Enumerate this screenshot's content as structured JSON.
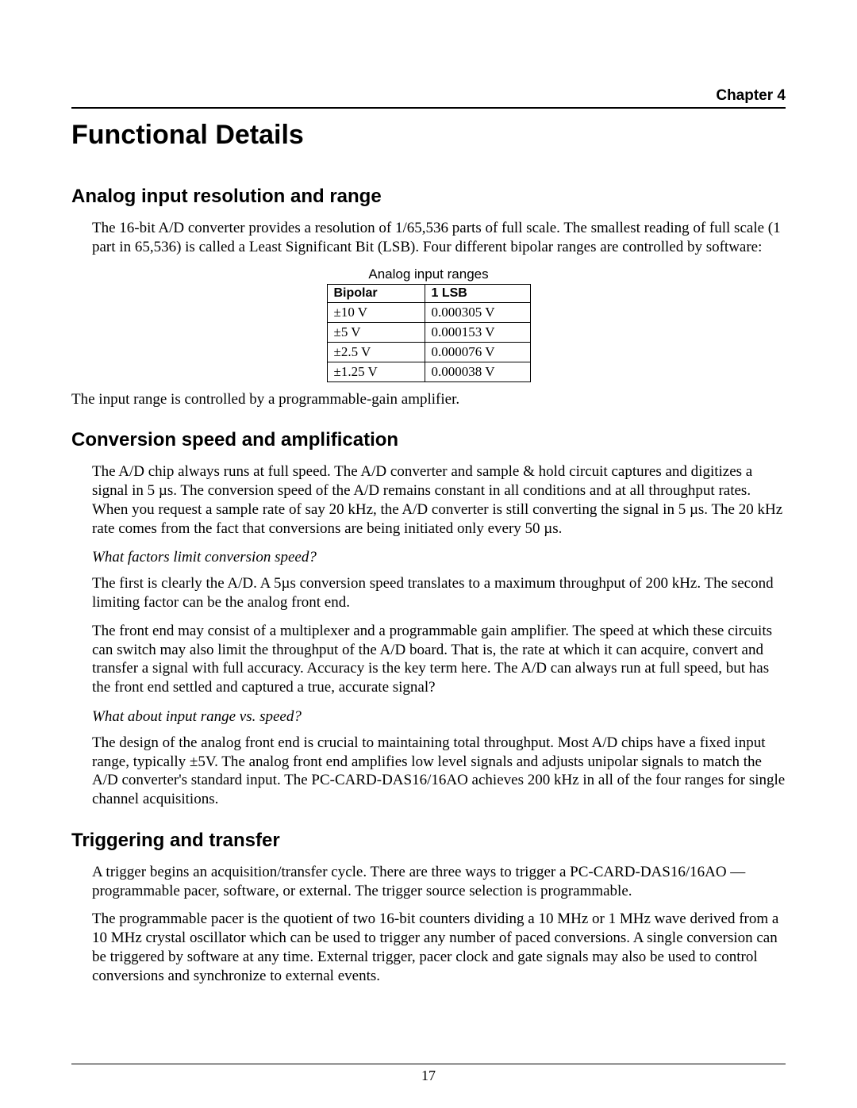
{
  "chapter_label": "Chapter 4",
  "chapter_title": "Functional Details",
  "page_number": "17",
  "sections": {
    "analog": {
      "heading": "Analog input resolution and range",
      "p1": "The 16-bit A/D converter provides a resolution of 1/65,536 parts of full scale. The smallest reading of full scale (1 part in 65,536) is called a Least Significant Bit (LSB). Four different bipolar ranges are controlled by software:",
      "table_caption": "Analog input ranges",
      "table_headers": {
        "c1": "Bipolar",
        "c2": "1 LSB"
      },
      "table_rows": [
        {
          "c1": "±10 V",
          "c2": "0.000305 V"
        },
        {
          "c1": "±5 V",
          "c2": "0.000153 V"
        },
        {
          "c1": "±2.5 V",
          "c2": "0.000076 V"
        },
        {
          "c1": "±1.25 V",
          "c2": "0.000038 V"
        }
      ],
      "p2": "The input range is controlled by a programmable-gain amplifier."
    },
    "conversion": {
      "heading": "Conversion speed and amplification",
      "p1": "The A/D chip always runs at full speed. The A/D converter and sample & hold circuit captures and digitizes a signal in 5 µs. The conversion speed of the A/D remains constant in all conditions and at all throughput rates. When you request a sample rate of say 20 kHz, the A/D converter is still converting the signal in 5 µs. The 20 kHz rate comes from the fact that conversions are being initiated only every 50 µs.",
      "q1": "What factors limit conversion speed?",
      "p2": "The first is clearly the A/D. A 5µs conversion speed translates to a maximum throughput of 200 kHz. The second limiting factor can be the analog front end.",
      "p3": "The front end may consist of a multiplexer and a programmable gain amplifier. The speed at which these circuits can switch may also limit the throughput of the A/D board. That is, the rate at which it can acquire, convert and transfer a signal with full accuracy. Accuracy is the key term here. The A/D can always run at full speed, but has the front end settled and captured a true, accurate signal?",
      "q2": "What about input range vs. speed?",
      "p4": "The design of the analog front end is crucial to maintaining total throughput. Most A/D chips have a fixed input range, typically ±5V. The analog front end amplifies low level signals and adjusts unipolar signals to match the A/D converter's standard input. The PC-CARD-DAS16/16AO achieves 200 kHz in all of the four ranges for single channel acquisitions."
    },
    "trigger": {
      "heading": "Triggering and transfer",
      "p1": "A trigger begins an acquisition/transfer cycle. There are three ways to trigger a PC-CARD-DAS16/16AO — programmable pacer, software, or external. The trigger source selection is programmable.",
      "p2": "The programmable pacer is the quotient of two 16-bit counters dividing a 10 MHz or 1 MHz wave derived from a 10 MHz crystal oscillator which can be used to trigger any number of paced conversions. A single conversion can be triggered by software at any time. External trigger, pacer clock and gate signals may also be used to control conversions and synchronize to external events."
    }
  }
}
